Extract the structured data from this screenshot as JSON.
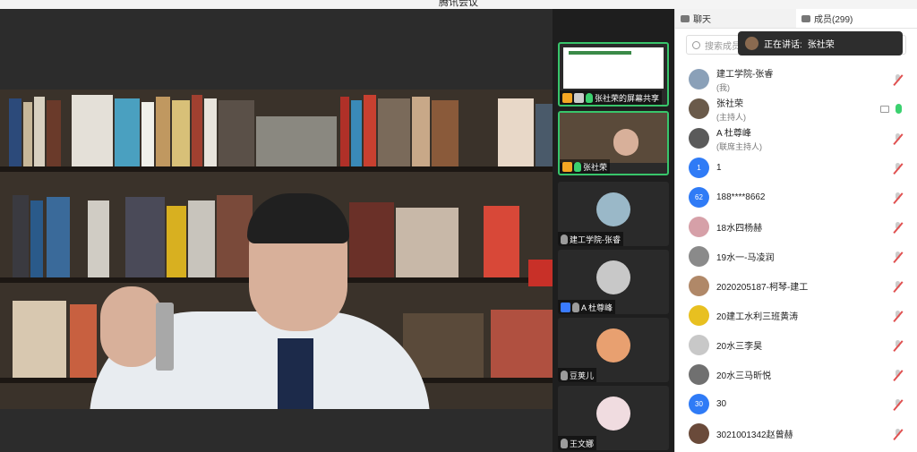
{
  "window": {
    "title": "腾讯会议"
  },
  "strip": {
    "tiles": [
      {
        "label": "张社荣的屏幕共享"
      },
      {
        "label": "张社荣"
      },
      {
        "label": "建工学院-张睿"
      },
      {
        "label": "A 杜尊峰"
      },
      {
        "label": "豆荚儿"
      },
      {
        "label": "王文娜"
      }
    ]
  },
  "panel": {
    "tab_chat": "聊天",
    "tab_members": "成员(299)",
    "search_placeholder": "搜索成员",
    "speaking_prefix": "正在讲话:",
    "speaking_name": "张社荣",
    "members": [
      {
        "name": "建工学院-张睿",
        "sub": "(我)",
        "avatar": "",
        "color": "#8aa0b8",
        "mic": "off"
      },
      {
        "name": "张社荣",
        "sub": "(主持人)",
        "avatar": "",
        "color": "#6a5a4a",
        "mic": "on"
      },
      {
        "name": "A 杜尊峰",
        "sub": "(联席主持人)",
        "avatar": "",
        "color": "#5a5a5a",
        "mic": "off"
      },
      {
        "name": "1",
        "sub": "",
        "avatar": "1",
        "color": "#2f7bf6",
        "mic": "off"
      },
      {
        "name": "188****8662",
        "sub": "",
        "avatar": "62",
        "color": "#2f7bf6",
        "mic": "off"
      },
      {
        "name": "18水四杨赫",
        "sub": "",
        "avatar": "",
        "color": "#d6a0a8",
        "mic": "off"
      },
      {
        "name": "19水一-马凌润",
        "sub": "",
        "avatar": "",
        "color": "#8a8a8a",
        "mic": "off"
      },
      {
        "name": "2020205187-柯琴-建工",
        "sub": "",
        "avatar": "",
        "color": "#b08868",
        "mic": "off"
      },
      {
        "name": "20建工水利三班黄涛",
        "sub": "",
        "avatar": "",
        "color": "#e8c020",
        "mic": "off"
      },
      {
        "name": "20水三李昊",
        "sub": "",
        "avatar": "",
        "color": "#c8c8c8",
        "mic": "off"
      },
      {
        "name": "20水三马昕悦",
        "sub": "",
        "avatar": "",
        "color": "#707070",
        "mic": "off"
      },
      {
        "name": "30",
        "sub": "",
        "avatar": "30",
        "color": "#2f7bf6",
        "mic": "off"
      },
      {
        "name": "3021001342赵曾赫",
        "sub": "",
        "avatar": "",
        "color": "#6a4a3a",
        "mic": "off"
      }
    ]
  },
  "colors": {
    "active": "#38c56b",
    "accent": "#2f7bf6",
    "mic_off": "#e05050"
  }
}
